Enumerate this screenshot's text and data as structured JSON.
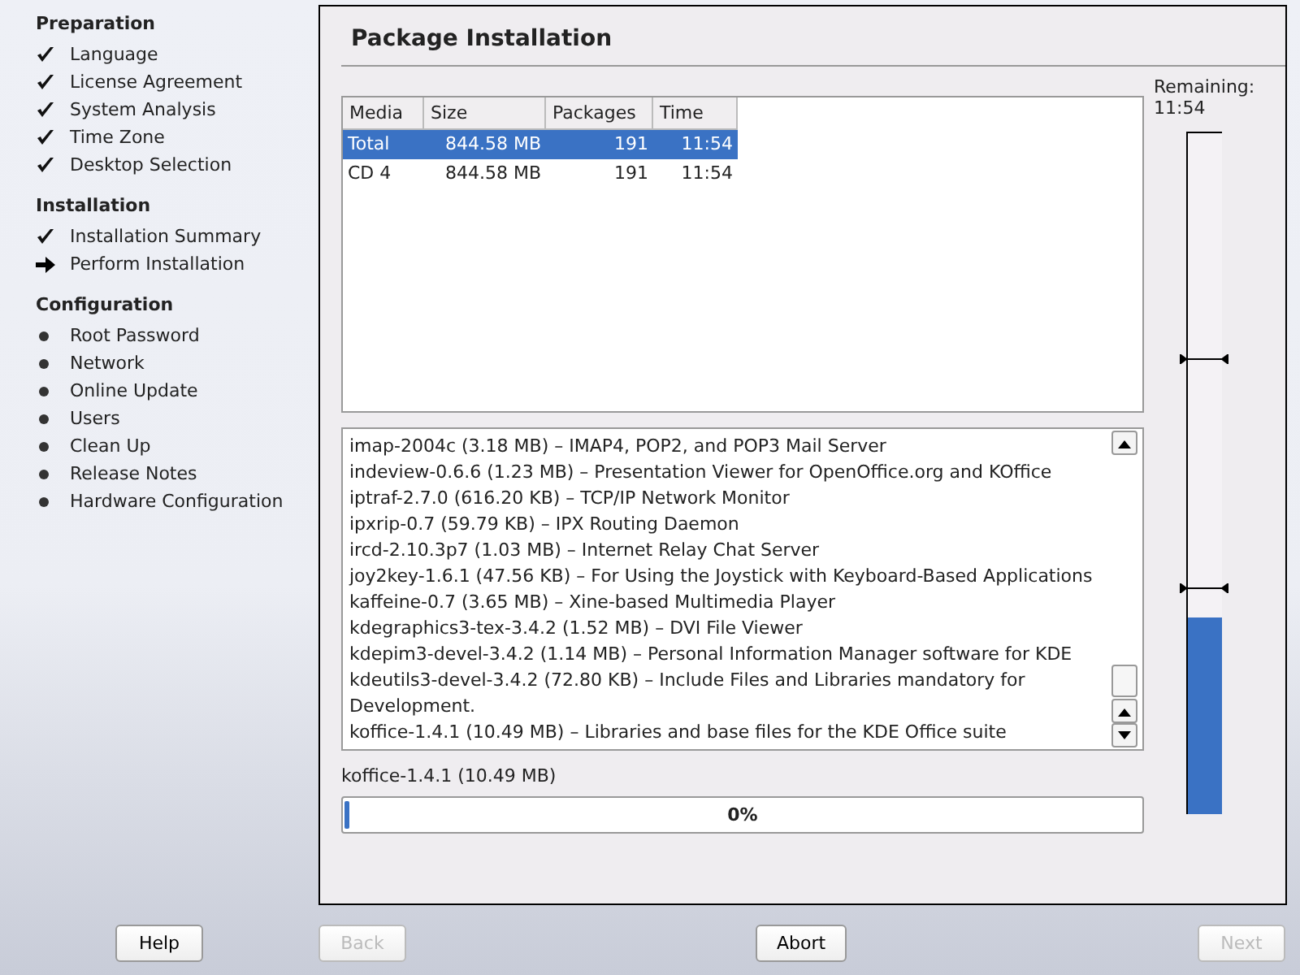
{
  "sidebar": {
    "sections": [
      {
        "title": "Preparation",
        "items": [
          {
            "label": "Language",
            "kind": "done"
          },
          {
            "label": "License Agreement",
            "kind": "done"
          },
          {
            "label": "System Analysis",
            "kind": "done"
          },
          {
            "label": "Time Zone",
            "kind": "done"
          },
          {
            "label": "Desktop Selection",
            "kind": "done"
          }
        ]
      },
      {
        "title": "Installation",
        "items": [
          {
            "label": "Installation Summary",
            "kind": "done"
          },
          {
            "label": "Perform Installation",
            "kind": "current"
          }
        ]
      },
      {
        "title": "Configuration",
        "items": [
          {
            "label": "Root Password",
            "kind": "pending"
          },
          {
            "label": "Network",
            "kind": "pending"
          },
          {
            "label": "Online Update",
            "kind": "pending"
          },
          {
            "label": "Users",
            "kind": "pending"
          },
          {
            "label": "Clean Up",
            "kind": "pending"
          },
          {
            "label": "Release Notes",
            "kind": "pending"
          },
          {
            "label": "Hardware Configuration",
            "kind": "pending"
          }
        ]
      }
    ]
  },
  "panel": {
    "title": "Package Installation",
    "table": {
      "columns": [
        "Media",
        "Size",
        "Packages",
        "Time"
      ],
      "rows": [
        {
          "cells": [
            "Total",
            "844.58 MB",
            "191",
            "11:54"
          ],
          "selected": true
        },
        {
          "cells": [
            "CD 4",
            "844.58 MB",
            "191",
            "11:54"
          ],
          "selected": false
        }
      ]
    },
    "log": [
      "imap-2004c (3.18 MB) – IMAP4, POP2, and POP3 Mail Server",
      "indeview-0.6.6 (1.23 MB) – Presentation Viewer for OpenOffice.org and KOffice",
      "iptraf-2.7.0 (616.20 KB) – TCP/IP Network Monitor",
      "ipxrip-0.7 (59.79 KB) – IPX Routing Daemon",
      "ircd-2.10.3p7 (1.03 MB) – Internet Relay Chat Server",
      "joy2key-1.6.1 (47.56 KB) – For Using the Joystick with Keyboard-Based Applications",
      "kaffeine-0.7 (3.65 MB) – Xine-based Multimedia Player",
      "kdegraphics3-tex-3.4.2 (1.52 MB) – DVI File Viewer",
      "kdepim3-devel-3.4.2 (1.14 MB) – Personal Information Manager software for KDE",
      "kdeutils3-devel-3.4.2 (72.80 KB) – Include Files and Libraries mandatory for Development.",
      "koffice-1.4.1 (10.49 MB) – Libraries and base files for the KDE Office suite"
    ],
    "current_package": "koffice-1.4.1 (10.49 MB)",
    "progress": {
      "level": 0,
      "label": "0%"
    },
    "remaining": {
      "label": "Remaining:",
      "time": "11:54",
      "level": 0.29
    }
  },
  "buttons": [
    {
      "label": "Help",
      "disabled": false
    },
    {
      "label": "Back",
      "disabled": true
    },
    {
      "label": "Abort",
      "disabled": false
    },
    {
      "label": "Next",
      "disabled": true
    }
  ]
}
